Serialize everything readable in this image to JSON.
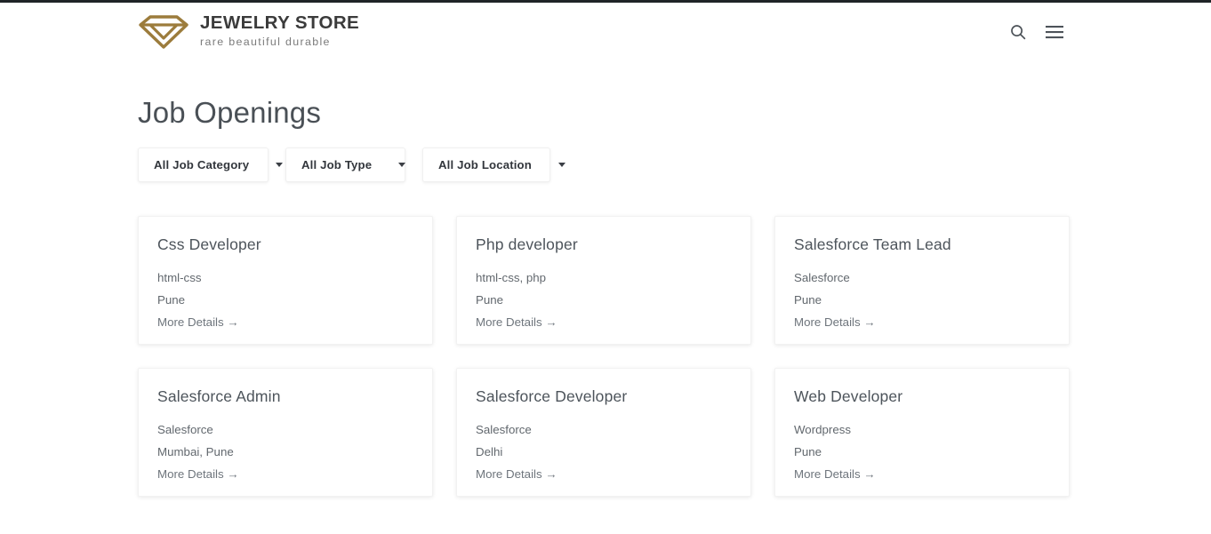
{
  "header": {
    "brand_name": "JEWELRY STORE",
    "brand_tagline": "rare beautiful durable",
    "logo_icon": "diamond-gem-icon",
    "logo_color": "#9c7c3c",
    "search_icon": "search-icon",
    "menu_icon": "hamburger-menu-icon"
  },
  "main": {
    "page_title": "Job Openings",
    "filters": [
      {
        "label": "All Job Category",
        "caret_icon": "chevron-down-icon"
      },
      {
        "label": "All Job Type",
        "caret_icon": "chevron-down-icon"
      },
      {
        "label": "All Job Location",
        "caret_icon": "chevron-down-icon"
      }
    ],
    "jobs": [
      {
        "title": "Css Developer",
        "category": "html-css",
        "location": "Pune",
        "link_label": "More Details →"
      },
      {
        "title": "Php developer",
        "category": "html-css, php",
        "location": "Pune",
        "link_label": "More Details →"
      },
      {
        "title": "Salesforce Team Lead",
        "category": "Salesforce",
        "location": "Pune",
        "link_label": "More Details →"
      },
      {
        "title": "Salesforce Admin",
        "category": "Salesforce",
        "location": "Mumbai, Pune",
        "link_label": "More Details →"
      },
      {
        "title": "Salesforce Developer",
        "category": "Salesforce",
        "location": "Delhi",
        "link_label": "More Details →"
      },
      {
        "title": "Web Developer",
        "category": "Wordpress",
        "location": "Pune",
        "link_label": "More Details →"
      }
    ]
  },
  "colors": {
    "top_strip": "#1f2427",
    "brand_gold": "#9c7c3c",
    "title_text": "#4a5056",
    "body_text": "#62686e"
  }
}
